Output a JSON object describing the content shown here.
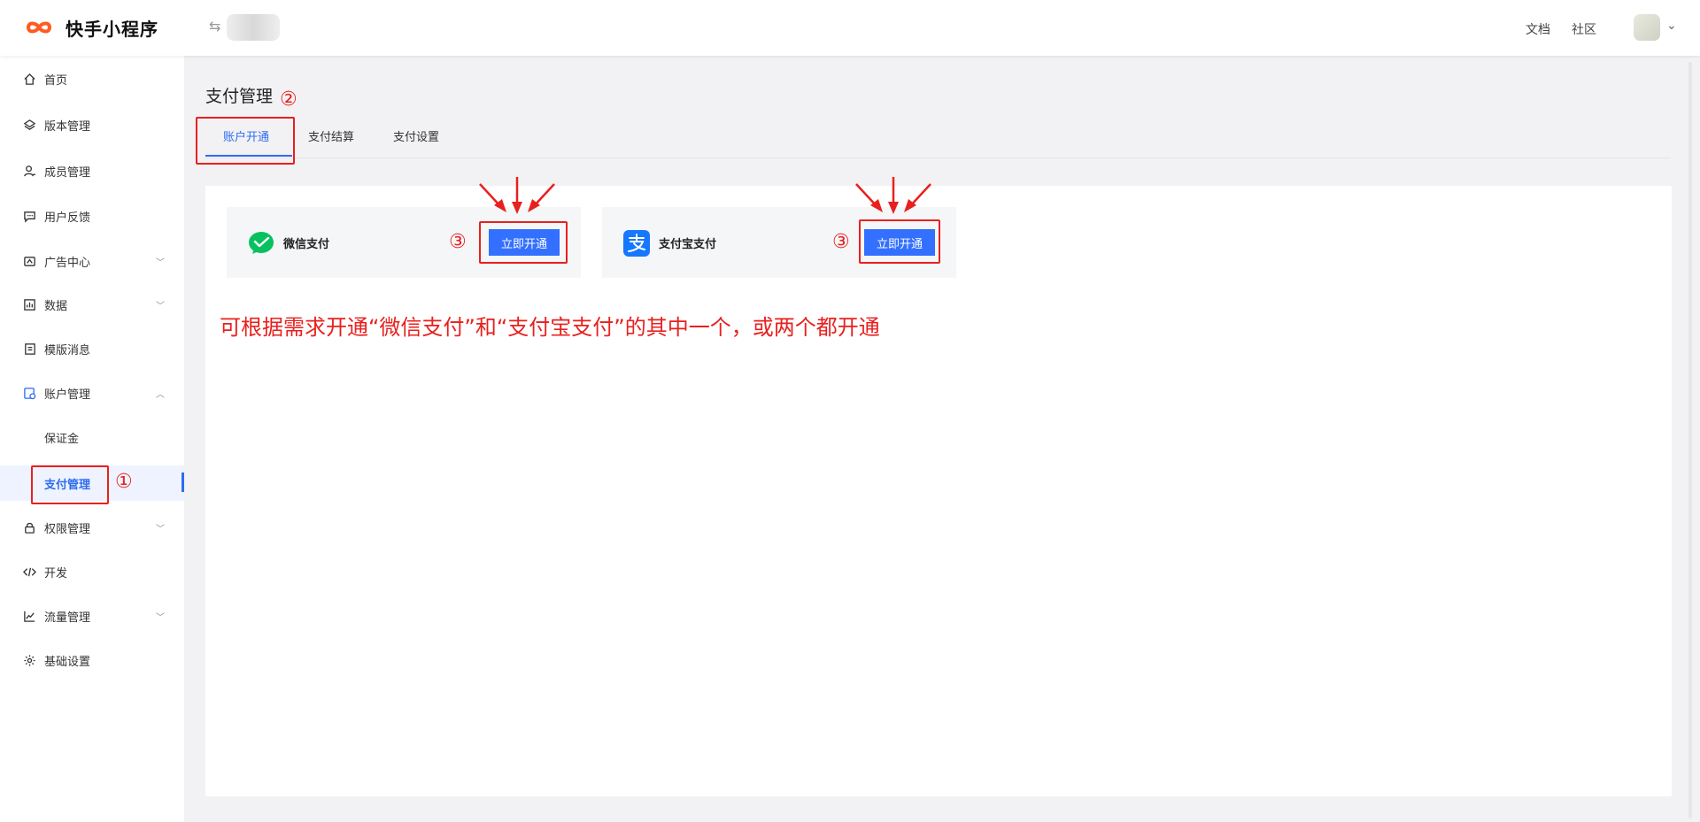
{
  "header": {
    "brand": "快手小程序",
    "switch_icon": "⇆",
    "links": [
      "文档",
      "社区"
    ]
  },
  "sidebar": {
    "items": [
      {
        "label": "首页",
        "icon": "home-icon"
      },
      {
        "label": "版本管理",
        "icon": "layers-icon"
      },
      {
        "label": "成员管理",
        "icon": "user-icon"
      },
      {
        "label": "用户反馈",
        "icon": "message-icon"
      },
      {
        "label": "广告中心",
        "icon": "ad-icon",
        "expandable": true
      },
      {
        "label": "数据",
        "icon": "chart-icon",
        "expandable": true
      },
      {
        "label": "模版消息",
        "icon": "template-icon"
      },
      {
        "label": "账户管理",
        "icon": "account-icon",
        "expandable": true,
        "expanded": true
      },
      {
        "label": "保证金",
        "sub": true
      },
      {
        "label": "支付管理",
        "sub": true,
        "active": true
      },
      {
        "label": "权限管理",
        "icon": "lock-icon",
        "expandable": true
      },
      {
        "label": "开发",
        "icon": "code-icon"
      },
      {
        "label": "流量管理",
        "icon": "trend-icon",
        "expandable": true
      },
      {
        "label": "基础设置",
        "icon": "gear-icon"
      }
    ]
  },
  "main": {
    "title": "支付管理",
    "tabs": [
      "账户开通",
      "支付结算",
      "支付设置"
    ],
    "active_tab": "账户开通",
    "payments": [
      {
        "name": "微信支付",
        "button": "立即开通",
        "icon": "wechat-pay-icon"
      },
      {
        "name": "支付宝支付",
        "button": "立即开通",
        "icon": "alipay-icon"
      }
    ]
  },
  "annotations": {
    "markers": [
      "①",
      "②",
      "③",
      "③"
    ],
    "note": "可根据需求开通“微信支付”和“支付宝支付”的其中一个，或两个都开通",
    "color": "#e8201e"
  },
  "colors": {
    "accent": "#3370ff",
    "logo": "#ff5a1f",
    "wechat": "#07c160",
    "alipay": "#1677ff"
  }
}
